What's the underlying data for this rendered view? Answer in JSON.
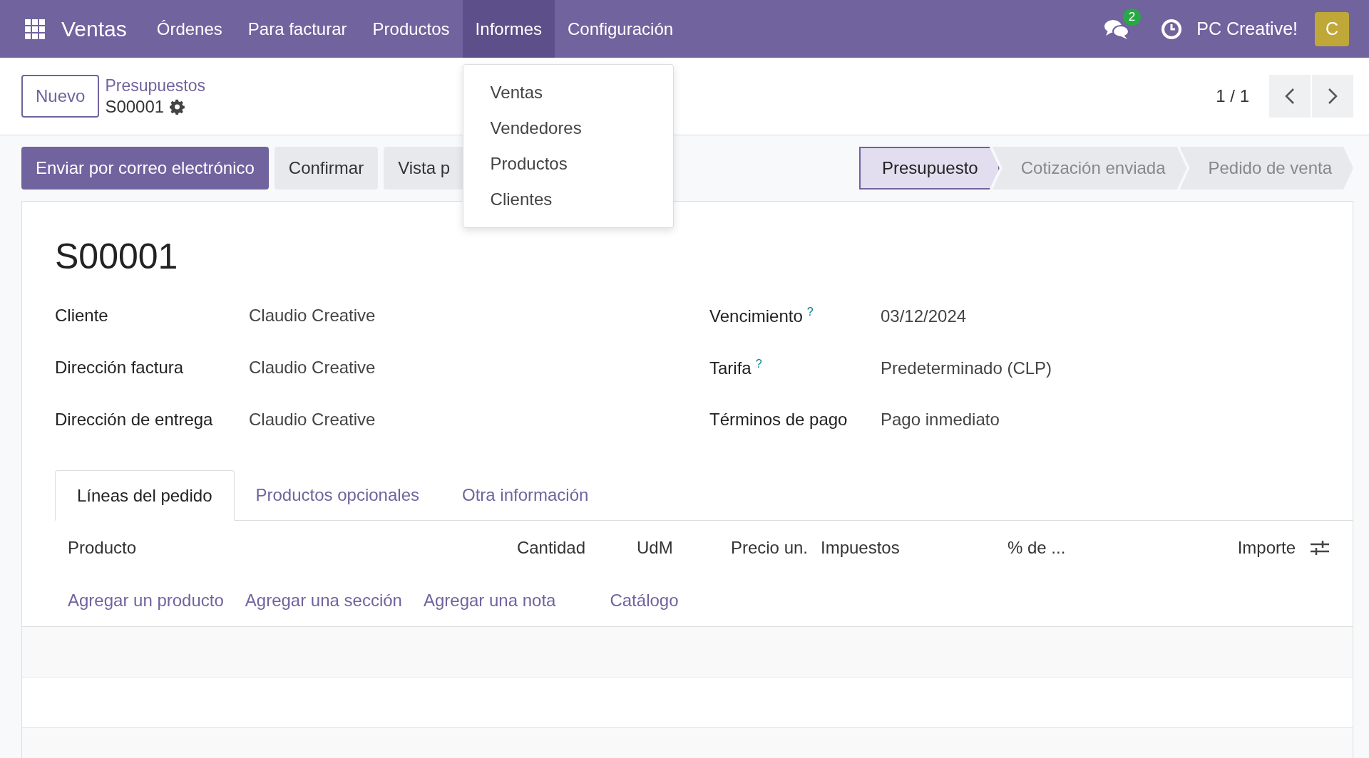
{
  "navbar": {
    "app_name": "Ventas",
    "menu": [
      {
        "label": "Órdenes",
        "expanded": false
      },
      {
        "label": "Para facturar",
        "expanded": false
      },
      {
        "label": "Productos",
        "expanded": false
      },
      {
        "label": "Informes",
        "expanded": true,
        "submenu": [
          "Ventas",
          "Vendedores",
          "Productos",
          "Clientes"
        ]
      },
      {
        "label": "Configuración",
        "expanded": false
      }
    ],
    "messages_badge": "2",
    "user": "PC Creative!",
    "avatar": "C"
  },
  "control_panel": {
    "new_button": "Nuevo",
    "breadcrumb": "Presupuestos",
    "record": "S00001",
    "pager": "1 / 1"
  },
  "actions": [
    {
      "label": "Enviar por correo electrónico",
      "kind": "primary"
    },
    {
      "label": "Confirmar",
      "kind": "secondary"
    },
    {
      "label": "Vista p",
      "kind": "secondary"
    }
  ],
  "stages": [
    {
      "label": "Presupuesto",
      "selected": true
    },
    {
      "label": "Cotización enviada",
      "selected": false
    },
    {
      "label": "Pedido de venta",
      "selected": false
    }
  ],
  "form": {
    "title": "S00001",
    "left_fields": [
      {
        "label": "Cliente",
        "value": "Claudio Creative"
      },
      {
        "label": "Dirección factura",
        "value": "Claudio Creative"
      },
      {
        "label": "Dirección de entrega",
        "value": "Claudio Creative"
      }
    ],
    "right_fields": [
      {
        "label": "Vencimiento",
        "help": "?",
        "value": "03/12/2024"
      },
      {
        "label": "Tarifa",
        "help": "?",
        "value": "Predeterminado (CLP)"
      },
      {
        "label": "Términos de pago",
        "value": "Pago inmediato"
      }
    ],
    "tabs": [
      {
        "label": "Líneas del pedido",
        "selected": true
      },
      {
        "label": "Productos opcionales",
        "selected": false
      },
      {
        "label": "Otra información",
        "selected": false
      }
    ],
    "table": {
      "columns": [
        "Producto",
        "Cantidad",
        "UdM",
        "Precio un.",
        "Impuestos",
        "% de ...",
        "Importe"
      ],
      "add_links": [
        "Agregar un producto",
        "Agregar una sección",
        "Agregar una nota",
        "Catálogo"
      ]
    }
  }
}
